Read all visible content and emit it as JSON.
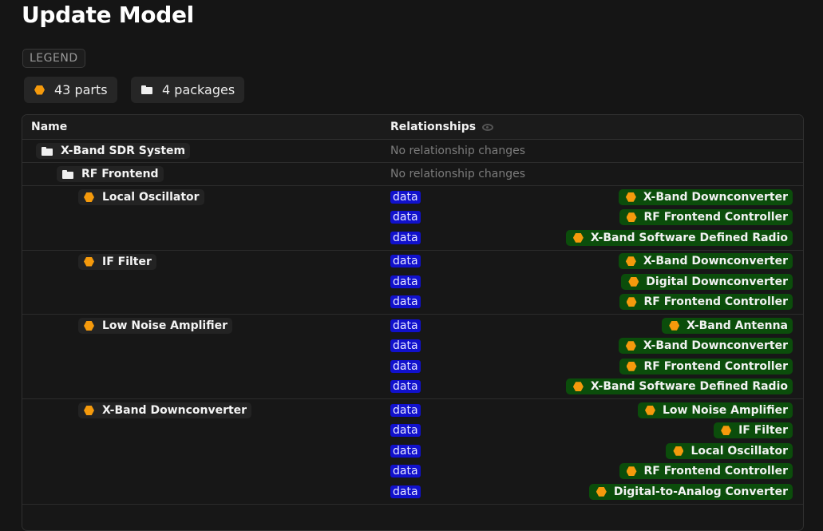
{
  "page": {
    "title": "Update Model",
    "legend_label": "LEGEND"
  },
  "stats": {
    "parts_count": "43",
    "parts_label": "parts",
    "packages_count": "4",
    "packages_label": "packages"
  },
  "table": {
    "col_name": "Name",
    "col_relationships": "Relationships",
    "no_changes_text": "No relationship changes",
    "rows": [
      {
        "name": "X-Band SDR System",
        "kind": "package",
        "indent": 1,
        "no_changes": "No relationship changes",
        "relationships": []
      },
      {
        "name": "RF Frontend",
        "kind": "package",
        "indent": 2,
        "no_changes": "No relationship changes",
        "relationships": []
      },
      {
        "name": "Local Oscillator",
        "kind": "part",
        "indent": 3,
        "relationships": [
          {
            "type": "data",
            "target": "X-Band Downconverter"
          },
          {
            "type": "data",
            "target": "RF Frontend Controller"
          },
          {
            "type": "data",
            "target": "X-Band Software Defined Radio"
          }
        ]
      },
      {
        "name": "IF Filter",
        "kind": "part",
        "indent": 3,
        "relationships": [
          {
            "type": "data",
            "target": "X-Band Downconverter"
          },
          {
            "type": "data",
            "target": "Digital Downconverter"
          },
          {
            "type": "data",
            "target": "RF Frontend Controller"
          }
        ]
      },
      {
        "name": "Low Noise Amplifier",
        "kind": "part",
        "indent": 3,
        "relationships": [
          {
            "type": "data",
            "target": "X-Band Antenna"
          },
          {
            "type": "data",
            "target": "X-Band Downconverter"
          },
          {
            "type": "data",
            "target": "RF Frontend Controller"
          },
          {
            "type": "data",
            "target": "X-Band Software Defined Radio"
          }
        ]
      },
      {
        "name": "X-Band Downconverter",
        "kind": "part",
        "indent": 3,
        "relationships": [
          {
            "type": "data",
            "target": "Low Noise Amplifier"
          },
          {
            "type": "data",
            "target": "IF Filter"
          },
          {
            "type": "data",
            "target": "Local Oscillator"
          },
          {
            "type": "data",
            "target": "RF Frontend Controller"
          },
          {
            "type": "data",
            "target": "Digital-to-Analog Converter"
          }
        ]
      }
    ]
  },
  "colors": {
    "part_icon": "#f59a0c",
    "data_tag": "#1111cc",
    "target_chip": "#0b4d0b"
  },
  "icons": {
    "part": "hexagon-icon",
    "package": "folder-icon",
    "visibility": "eye-icon"
  }
}
